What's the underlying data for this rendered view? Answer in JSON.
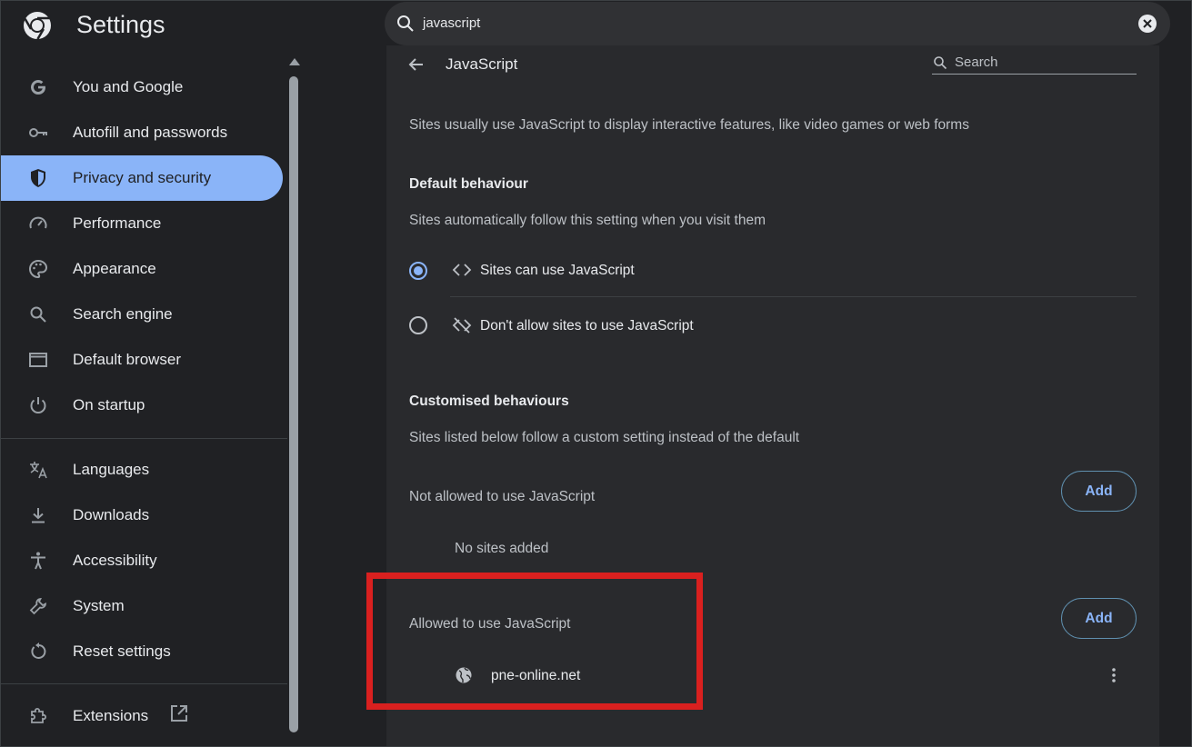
{
  "app": {
    "title": "Settings"
  },
  "search": {
    "value": "javascript"
  },
  "sidebar": {
    "items": [
      {
        "label": "You and Google",
        "icon": "google-g-icon"
      },
      {
        "label": "Autofill and passwords",
        "icon": "key-icon"
      },
      {
        "label": "Privacy and security",
        "icon": "shield-icon",
        "active": true
      },
      {
        "label": "Performance",
        "icon": "speedometer-icon"
      },
      {
        "label": "Appearance",
        "icon": "palette-icon"
      },
      {
        "label": "Search engine",
        "icon": "search-icon"
      },
      {
        "label": "Default browser",
        "icon": "browser-window-icon"
      },
      {
        "label": "On startup",
        "icon": "power-icon"
      },
      {
        "label": "Languages",
        "icon": "translate-icon"
      },
      {
        "label": "Downloads",
        "icon": "download-icon"
      },
      {
        "label": "Accessibility",
        "icon": "accessibility-icon"
      },
      {
        "label": "System",
        "icon": "wrench-icon"
      },
      {
        "label": "Reset settings",
        "icon": "reset-icon"
      },
      {
        "label": "Extensions",
        "icon": "puzzle-icon"
      }
    ]
  },
  "page": {
    "title": "JavaScript",
    "search_placeholder": "Search",
    "description": "Sites usually use JavaScript to display interactive features, like video games or web forms",
    "default_heading": "Default behaviour",
    "default_subtext": "Sites automatically follow this setting when you visit them",
    "option_allow": "Sites can use JavaScript",
    "option_block": "Don't allow sites to use JavaScript",
    "custom_heading": "Customised behaviours",
    "custom_subtext": "Sites listed below follow a custom setting instead of the default",
    "not_allowed_label": "Not allowed to use JavaScript",
    "add_label": "Add",
    "no_sites": "No sites added",
    "allowed_label": "Allowed to use JavaScript",
    "allowed_site": "pne-online.net"
  },
  "colors": {
    "accent": "#8ab4f8",
    "highlight": "#d9201f",
    "background": "#202124",
    "card": "#292a2d"
  }
}
